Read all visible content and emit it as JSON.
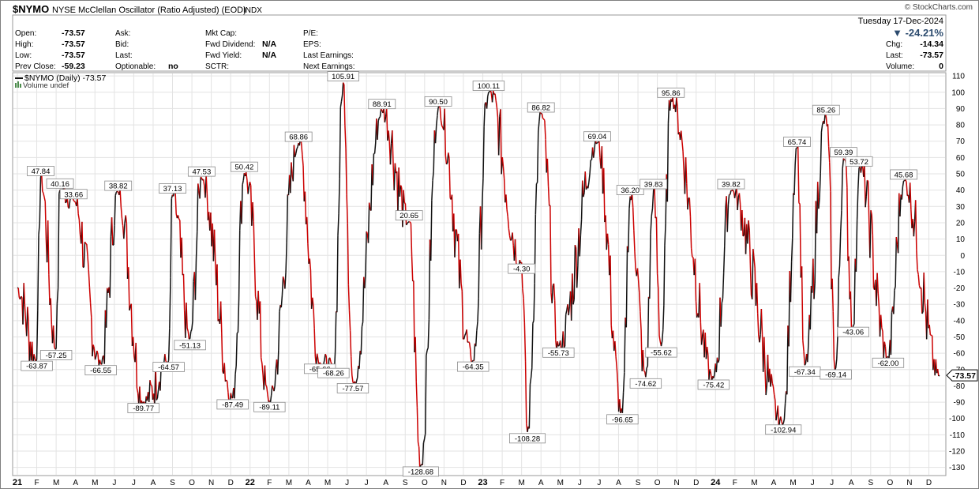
{
  "header": {
    "symbol": "$NYMO",
    "name": "NYSE McClellan Oscillator (Ratio Adjusted) (EOD)",
    "exchange": "INDX",
    "brand": "© StockCharts.com",
    "date": "Tuesday 17-Dec-2024",
    "change_pct": "▼ -24.21%"
  },
  "quote": {
    "open_label": "Open:",
    "open": "-73.57",
    "high_label": "High:",
    "high": "-73.57",
    "low_label": "Low:",
    "low": "-73.57",
    "prev_close_label": "Prev Close:",
    "prev_close": "-59.23",
    "ask_label": "Ask:",
    "bid_label": "Bid:",
    "last_label": "Last:",
    "optionable_label": "Optionable:",
    "optionable": "no",
    "mktcap_label": "Mkt Cap:",
    "fwd_div_label": "Fwd Dividend:",
    "fwd_div": "N/A",
    "fwd_yield_label": "Fwd Yield:",
    "fwd_yield": "N/A",
    "sctr_label": "SCTR:",
    "pe_label": "P/E:",
    "eps_label": "EPS:",
    "last_earn_label": "Last Earnings:",
    "next_earn_label": "Next Earnings:",
    "chg_label": "Chg:",
    "chg": "-14.34",
    "last2_label": "Last:",
    "last2": "-73.57",
    "volume_label": "Volume:",
    "volume": "0"
  },
  "legend": {
    "series": "$NYMO (Daily) -73.57",
    "volume": "Volume undef"
  },
  "colors": {
    "up": "#111111",
    "down": "#cc0000",
    "grid": "#e3e3e3",
    "frame": "#7f7f7f",
    "change_down": "#2c4b6e",
    "last_marker": "#000000"
  },
  "chart_data": {
    "type": "line",
    "ylim": [
      -135,
      112
    ],
    "yticks": [
      110,
      100,
      90,
      80,
      70,
      60,
      50,
      40,
      30,
      20,
      10,
      0,
      -10,
      -20,
      -30,
      -40,
      -50,
      -60,
      -70,
      -80,
      -90,
      -100,
      -110,
      -120,
      -130
    ],
    "x_labels": [
      {
        "t": 0,
        "text": "21",
        "year": true
      },
      {
        "t": 1,
        "text": "F"
      },
      {
        "t": 2,
        "text": "M"
      },
      {
        "t": 3,
        "text": "A"
      },
      {
        "t": 4,
        "text": "M"
      },
      {
        "t": 5,
        "text": "J"
      },
      {
        "t": 6,
        "text": "J"
      },
      {
        "t": 7,
        "text": "A"
      },
      {
        "t": 8,
        "text": "S"
      },
      {
        "t": 9,
        "text": "O"
      },
      {
        "t": 10,
        "text": "N"
      },
      {
        "t": 11,
        "text": "D"
      },
      {
        "t": 12,
        "text": "22",
        "year": true
      },
      {
        "t": 13,
        "text": "F"
      },
      {
        "t": 14,
        "text": "M"
      },
      {
        "t": 15,
        "text": "A"
      },
      {
        "t": 16,
        "text": "M"
      },
      {
        "t": 17,
        "text": "J"
      },
      {
        "t": 18,
        "text": "J"
      },
      {
        "t": 19,
        "text": "A"
      },
      {
        "t": 20,
        "text": "S"
      },
      {
        "t": 21,
        "text": "O"
      },
      {
        "t": 22,
        "text": "N"
      },
      {
        "t": 23,
        "text": "D"
      },
      {
        "t": 24,
        "text": "23",
        "year": true
      },
      {
        "t": 25,
        "text": "F"
      },
      {
        "t": 26,
        "text": "M"
      },
      {
        "t": 27,
        "text": "A"
      },
      {
        "t": 28,
        "text": "M"
      },
      {
        "t": 29,
        "text": "J"
      },
      {
        "t": 30,
        "text": "J"
      },
      {
        "t": 31,
        "text": "A"
      },
      {
        "t": 32,
        "text": "S"
      },
      {
        "t": 33,
        "text": "O"
      },
      {
        "t": 34,
        "text": "N"
      },
      {
        "t": 35,
        "text": "D"
      },
      {
        "t": 36,
        "text": "24",
        "year": true
      },
      {
        "t": 37,
        "text": "F"
      },
      {
        "t": 38,
        "text": "M"
      },
      {
        "t": 39,
        "text": "A"
      },
      {
        "t": 40,
        "text": "M"
      },
      {
        "t": 41,
        "text": "J"
      },
      {
        "t": 42,
        "text": "J"
      },
      {
        "t": 43,
        "text": "A"
      },
      {
        "t": 44,
        "text": "S"
      },
      {
        "t": 45,
        "text": "O"
      },
      {
        "t": 46,
        "text": "N"
      },
      {
        "t": 47,
        "text": "D"
      }
    ],
    "x_end": 47.55,
    "annotations": [
      {
        "t": 1.2,
        "v": 47.84,
        "text": "47.84"
      },
      {
        "t": 1.0,
        "v": -63.87,
        "text": "-63.87"
      },
      {
        "t": 2.2,
        "v": 40.16,
        "text": "40.16"
      },
      {
        "t": 2.0,
        "v": -57.25,
        "text": "-57.25"
      },
      {
        "t": 2.9,
        "v": 33.66,
        "text": "33.66"
      },
      {
        "t": 4.3,
        "v": -66.55,
        "text": "-66.55"
      },
      {
        "t": 5.2,
        "v": 38.82,
        "text": "38.82"
      },
      {
        "t": 6.5,
        "v": -89.77,
        "text": "-89.77"
      },
      {
        "t": 7.8,
        "v": -64.57,
        "text": "-64.57"
      },
      {
        "t": 8.0,
        "v": 37.13,
        "text": "37.13"
      },
      {
        "t": 8.9,
        "v": -51.13,
        "text": "-51.13"
      },
      {
        "t": 9.5,
        "v": 47.53,
        "text": "47.53"
      },
      {
        "t": 11.1,
        "v": -87.49,
        "text": "-87.49"
      },
      {
        "t": 11.7,
        "v": 50.42,
        "text": "50.42"
      },
      {
        "t": 13.0,
        "v": -89.11,
        "text": "-89.11"
      },
      {
        "t": 14.5,
        "v": 68.86,
        "text": "68.86"
      },
      {
        "t": 15.6,
        "v": -65.66,
        "text": "-65.66"
      },
      {
        "t": 16.3,
        "v": -68.26,
        "text": "-68.26"
      },
      {
        "t": 16.8,
        "v": 105.91,
        "text": "105.91"
      },
      {
        "t": 17.3,
        "v": -77.57,
        "text": "-77.57"
      },
      {
        "t": 18.8,
        "v": 88.91,
        "text": "88.91"
      },
      {
        "t": 20.2,
        "v": 20.65,
        "text": "20.65"
      },
      {
        "t": 20.8,
        "v": -128.68,
        "text": "-128.68"
      },
      {
        "t": 21.7,
        "v": 90.5,
        "text": "90.50"
      },
      {
        "t": 23.5,
        "v": -64.35,
        "text": "-64.35"
      },
      {
        "t": 24.3,
        "v": 100.11,
        "text": "100.11"
      },
      {
        "t": 26.0,
        "v": -4.3,
        "text": "-4.30"
      },
      {
        "t": 26.3,
        "v": -108.28,
        "text": "-108.28"
      },
      {
        "t": 27.0,
        "v": 86.82,
        "text": "86.82"
      },
      {
        "t": 27.9,
        "v": -55.73,
        "text": "-55.73"
      },
      {
        "t": 29.9,
        "v": 69.04,
        "text": "69.04"
      },
      {
        "t": 31.2,
        "v": -96.65,
        "text": "-96.65"
      },
      {
        "t": 31.6,
        "v": 36.2,
        "text": "36.20"
      },
      {
        "t": 32.4,
        "v": -74.62,
        "text": "-74.62"
      },
      {
        "t": 32.8,
        "v": 39.83,
        "text": "39.83"
      },
      {
        "t": 33.2,
        "v": -55.62,
        "text": "-55.62"
      },
      {
        "t": 33.7,
        "v": 95.86,
        "text": "95.86"
      },
      {
        "t": 35.9,
        "v": -75.42,
        "text": "-75.42"
      },
      {
        "t": 36.8,
        "v": 39.82,
        "text": "39.82"
      },
      {
        "t": 39.5,
        "v": -102.94,
        "text": "-102.94"
      },
      {
        "t": 40.2,
        "v": 65.74,
        "text": "65.74"
      },
      {
        "t": 40.6,
        "v": -67.34,
        "text": "-67.34"
      },
      {
        "t": 41.7,
        "v": 85.26,
        "text": "85.26"
      },
      {
        "t": 42.2,
        "v": -69.14,
        "text": "-69.14"
      },
      {
        "t": 42.6,
        "v": 59.39,
        "text": "59.39"
      },
      {
        "t": 43.4,
        "v": 53.72,
        "text": "53.72"
      },
      {
        "t": 43.1,
        "v": -43.06,
        "text": "-43.06"
      },
      {
        "t": 44.9,
        "v": -62.0,
        "text": "-62.00"
      },
      {
        "t": 45.7,
        "v": 45.68,
        "text": "45.68"
      }
    ],
    "last_value": "-73.57",
    "grid": true,
    "legend_position": "top-left"
  }
}
